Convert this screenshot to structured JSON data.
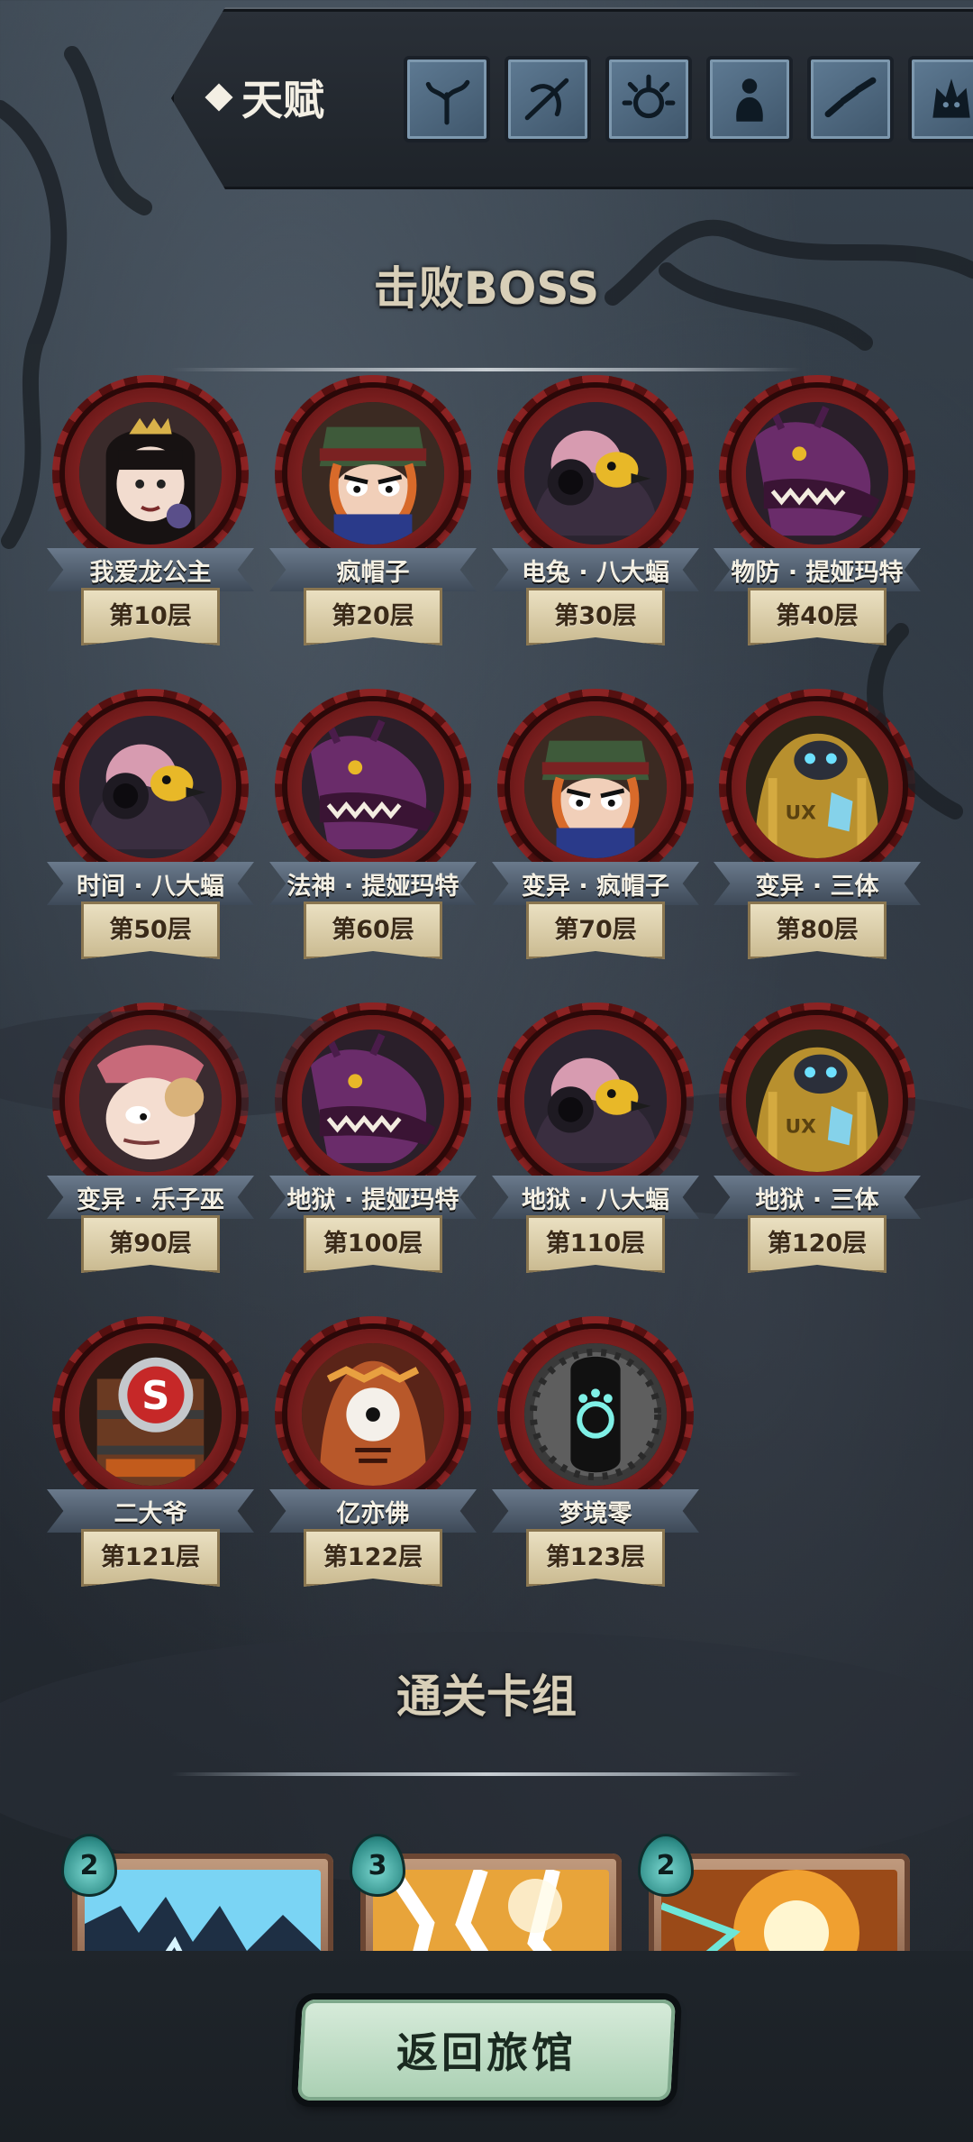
{
  "header": {
    "talent_label": "天赋",
    "talent_icons": [
      "plant-icon",
      "crossbow-icon",
      "gear-spirit-icon",
      "potion-bag-icon",
      "chain-icon",
      "demon-face-icon"
    ]
  },
  "boss_section": {
    "title": "击败BOSS",
    "bosses": [
      {
        "name": "我爱龙公主",
        "floor": "第10层",
        "portrait": "princess-portrait"
      },
      {
        "name": "疯帽子",
        "floor": "第20层",
        "portrait": "mad-hatter-portrait"
      },
      {
        "name": "电兔 · 八大蝠",
        "floor": "第30层",
        "portrait": "bat-bird-portrait"
      },
      {
        "name": "物防 · 提娅玛特",
        "floor": "第40层",
        "portrait": "dragon-portrait"
      },
      {
        "name": "时间 · 八大蝠",
        "floor": "第50层",
        "portrait": "bat-bird-portrait"
      },
      {
        "name": "法神 · 提娅玛特",
        "floor": "第60层",
        "portrait": "dragon-portrait"
      },
      {
        "name": "变异 · 疯帽子",
        "floor": "第70层",
        "portrait": "mad-hatter-portrait"
      },
      {
        "name": "变异 · 三体",
        "floor": "第80层",
        "portrait": "golden-robot-portrait"
      },
      {
        "name": "变异 · 乐子巫",
        "floor": "第90层",
        "portrait": "witch-portrait"
      },
      {
        "name": "地狱 · 提娅玛特",
        "floor": "第100层",
        "portrait": "dragon-portrait"
      },
      {
        "name": "地狱 · 八大蝠",
        "floor": "第110层",
        "portrait": "bat-bird-portrait"
      },
      {
        "name": "地狱 · 三体",
        "floor": "第120层",
        "portrait": "golden-robot-portrait"
      },
      {
        "name": "二大爷",
        "floor": "第121层",
        "portrait": "barrel-portrait"
      },
      {
        "name": "亿亦佛",
        "floor": "第122层",
        "portrait": "eye-monster-portrait"
      },
      {
        "name": "梦境零",
        "floor": "第123层",
        "portrait": "mask-portrait"
      }
    ]
  },
  "deck_section": {
    "title": "通关卡组",
    "cards": [
      {
        "cost": "2",
        "art": "blue-lightning-art"
      },
      {
        "cost": "3",
        "art": "white-flash-art"
      },
      {
        "cost": "2",
        "art": "orange-blast-art"
      }
    ]
  },
  "footer": {
    "back_label": "返回旅馆"
  },
  "colors": {
    "ring": "#7a1e1e",
    "ribbon": "#5a6a7c",
    "banner": "#e0d3ae",
    "button": "#c4e2cb"
  }
}
